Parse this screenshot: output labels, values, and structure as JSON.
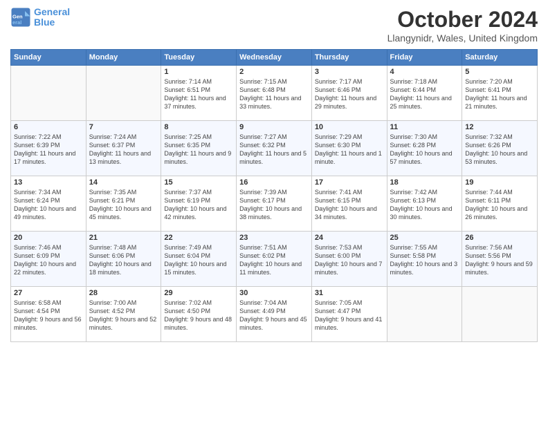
{
  "header": {
    "logo_line1": "General",
    "logo_line2": "Blue",
    "month_title": "October 2024",
    "subtitle": "Llangynidr, Wales, United Kingdom"
  },
  "days_of_week": [
    "Sunday",
    "Monday",
    "Tuesday",
    "Wednesday",
    "Thursday",
    "Friday",
    "Saturday"
  ],
  "weeks": [
    [
      {
        "day": "",
        "info": ""
      },
      {
        "day": "",
        "info": ""
      },
      {
        "day": "1",
        "info": "Sunrise: 7:14 AM\nSunset: 6:51 PM\nDaylight: 11 hours and 37 minutes."
      },
      {
        "day": "2",
        "info": "Sunrise: 7:15 AM\nSunset: 6:48 PM\nDaylight: 11 hours and 33 minutes."
      },
      {
        "day": "3",
        "info": "Sunrise: 7:17 AM\nSunset: 6:46 PM\nDaylight: 11 hours and 29 minutes."
      },
      {
        "day": "4",
        "info": "Sunrise: 7:18 AM\nSunset: 6:44 PM\nDaylight: 11 hours and 25 minutes."
      },
      {
        "day": "5",
        "info": "Sunrise: 7:20 AM\nSunset: 6:41 PM\nDaylight: 11 hours and 21 minutes."
      }
    ],
    [
      {
        "day": "6",
        "info": "Sunrise: 7:22 AM\nSunset: 6:39 PM\nDaylight: 11 hours and 17 minutes."
      },
      {
        "day": "7",
        "info": "Sunrise: 7:24 AM\nSunset: 6:37 PM\nDaylight: 11 hours and 13 minutes."
      },
      {
        "day": "8",
        "info": "Sunrise: 7:25 AM\nSunset: 6:35 PM\nDaylight: 11 hours and 9 minutes."
      },
      {
        "day": "9",
        "info": "Sunrise: 7:27 AM\nSunset: 6:32 PM\nDaylight: 11 hours and 5 minutes."
      },
      {
        "day": "10",
        "info": "Sunrise: 7:29 AM\nSunset: 6:30 PM\nDaylight: 11 hours and 1 minute."
      },
      {
        "day": "11",
        "info": "Sunrise: 7:30 AM\nSunset: 6:28 PM\nDaylight: 10 hours and 57 minutes."
      },
      {
        "day": "12",
        "info": "Sunrise: 7:32 AM\nSunset: 6:26 PM\nDaylight: 10 hours and 53 minutes."
      }
    ],
    [
      {
        "day": "13",
        "info": "Sunrise: 7:34 AM\nSunset: 6:24 PM\nDaylight: 10 hours and 49 minutes."
      },
      {
        "day": "14",
        "info": "Sunrise: 7:35 AM\nSunset: 6:21 PM\nDaylight: 10 hours and 45 minutes."
      },
      {
        "day": "15",
        "info": "Sunrise: 7:37 AM\nSunset: 6:19 PM\nDaylight: 10 hours and 42 minutes."
      },
      {
        "day": "16",
        "info": "Sunrise: 7:39 AM\nSunset: 6:17 PM\nDaylight: 10 hours and 38 minutes."
      },
      {
        "day": "17",
        "info": "Sunrise: 7:41 AM\nSunset: 6:15 PM\nDaylight: 10 hours and 34 minutes."
      },
      {
        "day": "18",
        "info": "Sunrise: 7:42 AM\nSunset: 6:13 PM\nDaylight: 10 hours and 30 minutes."
      },
      {
        "day": "19",
        "info": "Sunrise: 7:44 AM\nSunset: 6:11 PM\nDaylight: 10 hours and 26 minutes."
      }
    ],
    [
      {
        "day": "20",
        "info": "Sunrise: 7:46 AM\nSunset: 6:09 PM\nDaylight: 10 hours and 22 minutes."
      },
      {
        "day": "21",
        "info": "Sunrise: 7:48 AM\nSunset: 6:06 PM\nDaylight: 10 hours and 18 minutes."
      },
      {
        "day": "22",
        "info": "Sunrise: 7:49 AM\nSunset: 6:04 PM\nDaylight: 10 hours and 15 minutes."
      },
      {
        "day": "23",
        "info": "Sunrise: 7:51 AM\nSunset: 6:02 PM\nDaylight: 10 hours and 11 minutes."
      },
      {
        "day": "24",
        "info": "Sunrise: 7:53 AM\nSunset: 6:00 PM\nDaylight: 10 hours and 7 minutes."
      },
      {
        "day": "25",
        "info": "Sunrise: 7:55 AM\nSunset: 5:58 PM\nDaylight: 10 hours and 3 minutes."
      },
      {
        "day": "26",
        "info": "Sunrise: 7:56 AM\nSunset: 5:56 PM\nDaylight: 9 hours and 59 minutes."
      }
    ],
    [
      {
        "day": "27",
        "info": "Sunrise: 6:58 AM\nSunset: 4:54 PM\nDaylight: 9 hours and 56 minutes."
      },
      {
        "day": "28",
        "info": "Sunrise: 7:00 AM\nSunset: 4:52 PM\nDaylight: 9 hours and 52 minutes."
      },
      {
        "day": "29",
        "info": "Sunrise: 7:02 AM\nSunset: 4:50 PM\nDaylight: 9 hours and 48 minutes."
      },
      {
        "day": "30",
        "info": "Sunrise: 7:04 AM\nSunset: 4:49 PM\nDaylight: 9 hours and 45 minutes."
      },
      {
        "day": "31",
        "info": "Sunrise: 7:05 AM\nSunset: 4:47 PM\nDaylight: 9 hours and 41 minutes."
      },
      {
        "day": "",
        "info": ""
      },
      {
        "day": "",
        "info": ""
      }
    ]
  ]
}
